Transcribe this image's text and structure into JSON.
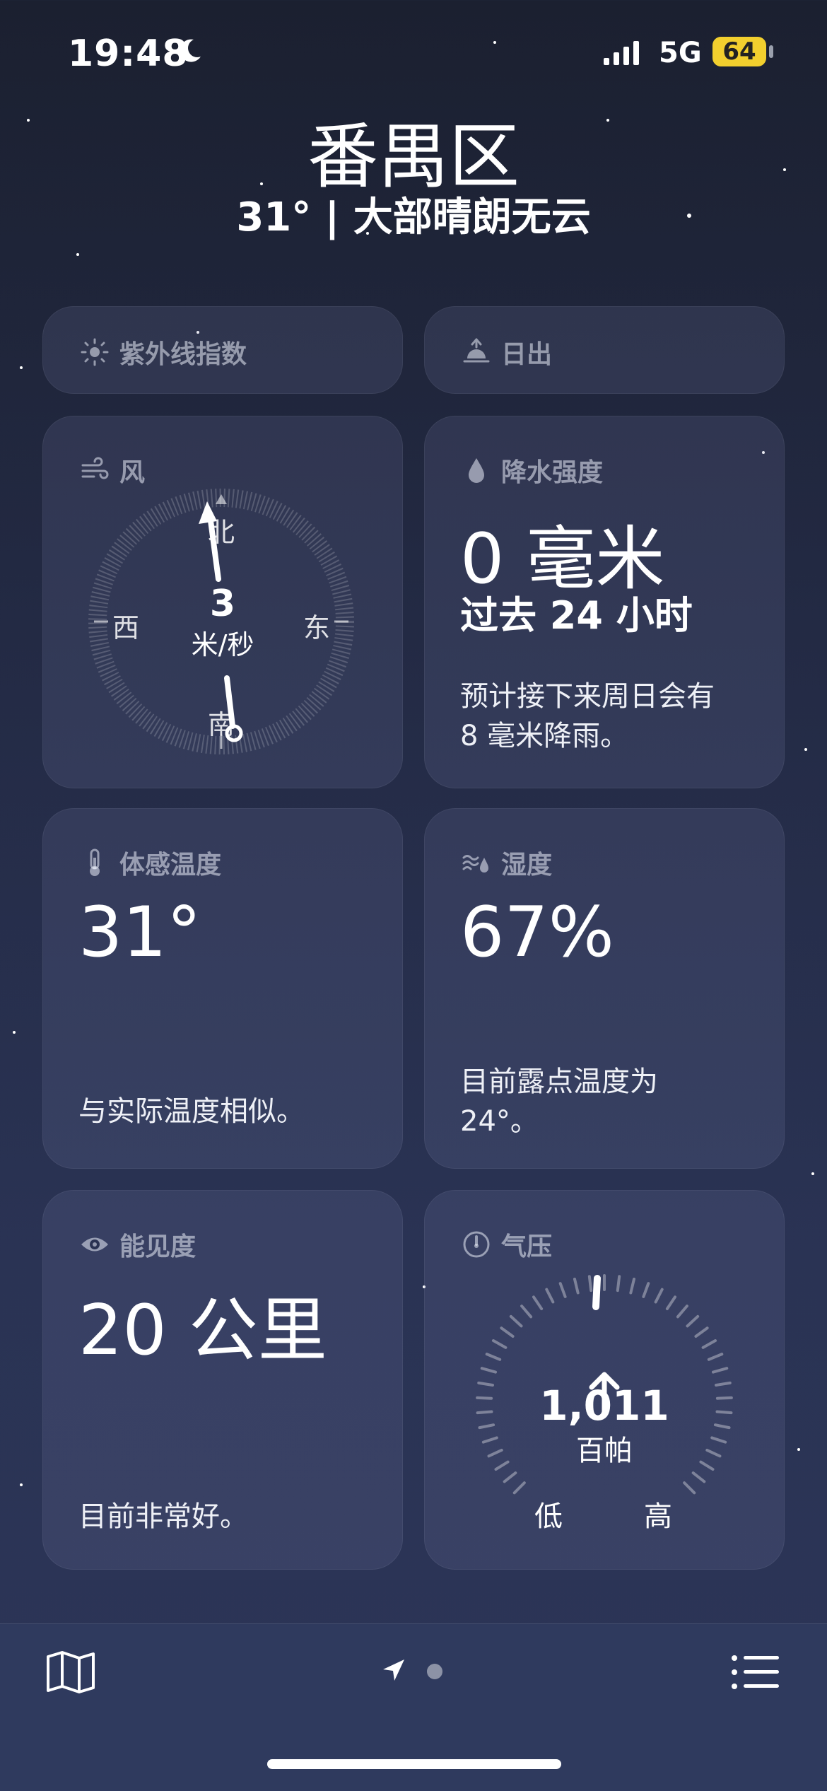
{
  "status": {
    "time": "19:48",
    "network": "5G",
    "battery": "64"
  },
  "header": {
    "city": "番禺区",
    "summary": "31° | 大部晴朗无云"
  },
  "cards": {
    "uv": {
      "label": "紫外线指数"
    },
    "sunrise": {
      "label": "日出"
    },
    "wind": {
      "label": "风",
      "speed": "3",
      "unit": "米/秒",
      "north": "北",
      "south": "南",
      "east": "东",
      "west": "西"
    },
    "precip": {
      "label": "降水强度",
      "value": "0 毫米",
      "period": "过去 24 小时",
      "note": "预计接下来周日会有 8 毫米降雨。"
    },
    "feels": {
      "label": "体感温度",
      "value": "31°",
      "note": "与实际温度相似。"
    },
    "humidity": {
      "label": "湿度",
      "value": "67%",
      "note": "目前露点温度为 24°。"
    },
    "visibility": {
      "label": "能见度",
      "value": "20 公里",
      "note": "目前非常好。"
    },
    "pressure": {
      "label": "气压",
      "value": "1,011",
      "unit": "百帕",
      "low": "低",
      "high": "高"
    }
  },
  "tabbar": {
    "map_icon": "map-icon",
    "location_icon": "location-arrow-icon",
    "list_icon": "list-icon"
  }
}
